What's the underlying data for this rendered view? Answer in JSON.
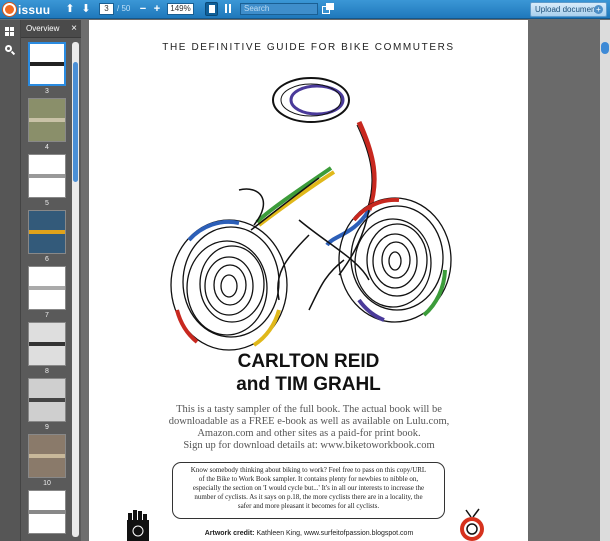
{
  "app": {
    "logo_text": "issuu",
    "brand_color": "#2a86cc"
  },
  "toolbar": {
    "current_page": "3",
    "total_pages": "/ 50",
    "zoom": "149%",
    "search_placeholder": "Search",
    "upload_label": "Upload document",
    "icons": [
      "arrow-up-icon",
      "arrow-down-icon",
      "zoom-out-icon",
      "zoom-in-icon",
      "single-page-view-icon",
      "two-page-view-icon",
      "share-icon",
      "plus-icon"
    ]
  },
  "overview": {
    "title": "Overview",
    "close_glyph": "×",
    "pages": [
      {
        "label": "3",
        "selected": true
      },
      {
        "label": "4",
        "selected": false
      },
      {
        "label": "5",
        "selected": false
      },
      {
        "label": "6",
        "selected": false
      },
      {
        "label": "7",
        "selected": false
      },
      {
        "label": "8",
        "selected": false
      },
      {
        "label": "9",
        "selected": false
      },
      {
        "label": "10",
        "selected": false
      },
      {
        "label": "",
        "selected": false
      }
    ]
  },
  "document": {
    "subtitle": "THE DEFINITIVE GUIDE FOR BIKE COMMUTERS",
    "authors_line1": "CARLTON REID",
    "authors_line2": "and TIM GRAHL",
    "blurb": [
      "This is a tasty sampler of the full book. The actual book will be",
      "downloadable as a FREE e-book as well as available on Lulu.com,",
      "Amazon.com and other sites as a paid-for print book.",
      "Sign up for download details at: www.biketoworkbook.com"
    ],
    "callout": [
      "Know somebody thinking about biking to work? Feel free to pass on this copy/URL",
      "of the Bike to Work Book sampler. It contains plenty for newbies to nibble on,",
      "especially the section on 'I would cycle but...' It's in all our interests to increase the",
      "number of cyclists. As it says on p.18, the more cyclists there are in a locality, the",
      "safer and more pleasant it becomes for all cyclists."
    ],
    "credit_label": "Artwork credit:",
    "credit_text": " Kathleen King, www.surfeitofpassion.blogspot.com"
  }
}
